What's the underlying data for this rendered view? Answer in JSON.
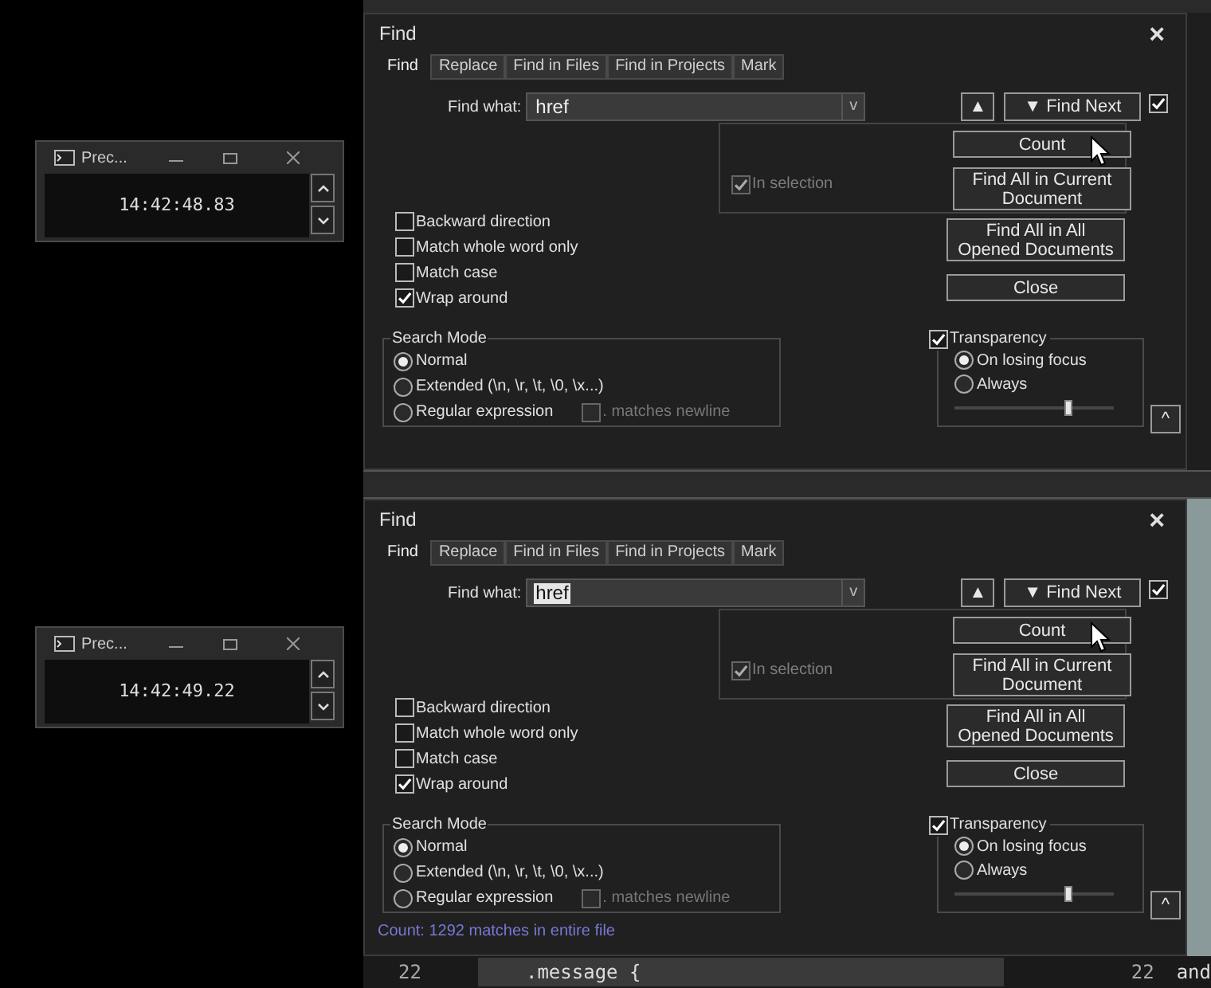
{
  "clocks": [
    {
      "title": "Prec...",
      "time": "14:42:48.83"
    },
    {
      "title": "Prec...",
      "time": "14:42:49.22"
    }
  ],
  "dialogs": [
    {
      "title": "Find",
      "close": "×",
      "tabs": [
        {
          "label": "Find",
          "selected": true
        },
        {
          "label": "Replace",
          "selected": false
        },
        {
          "label": "Find in Files",
          "selected": false
        },
        {
          "label": "Find in Projects",
          "selected": false
        },
        {
          "label": "Mark",
          "selected": false
        }
      ],
      "find_what_label": "Find what:",
      "find_what": "href",
      "text_selected": false,
      "dropdown": "v",
      "up": "▲",
      "find_next": "▼ Find Next",
      "stay_open": true,
      "in_selection": {
        "label": "In selection",
        "checked": true,
        "disabled": true
      },
      "buttons": [
        "Count",
        "Find All in Current Document",
        "Find All in All Opened Documents",
        "Close"
      ],
      "options": [
        {
          "label": "Backward direction",
          "checked": false
        },
        {
          "label": "Match whole word only",
          "checked": false
        },
        {
          "label": "Match case",
          "checked": false
        },
        {
          "label": "Wrap around",
          "checked": true
        }
      ],
      "search_mode": {
        "title": "Search Mode",
        "options": [
          {
            "label": "Normal",
            "selected": true
          },
          {
            "label": "Extended (\\n, \\r, \\t, \\0, \\x...)",
            "selected": false
          },
          {
            "label": "Regular expression",
            "selected": false
          }
        ],
        "dot_newline": {
          "label": ". matches newline",
          "checked": false,
          "disabled": true
        }
      },
      "transparency": {
        "label": "Transparency",
        "checked": true,
        "options": [
          {
            "label": "On losing focus",
            "selected": true
          },
          {
            "label": "Always",
            "selected": false
          }
        ],
        "level": 0.72
      },
      "collapse": "^"
    },
    {
      "title": "Find",
      "close": "×",
      "tabs": [
        {
          "label": "Find",
          "selected": true
        },
        {
          "label": "Replace",
          "selected": false
        },
        {
          "label": "Find in Files",
          "selected": false
        },
        {
          "label": "Find in Projects",
          "selected": false
        },
        {
          "label": "Mark",
          "selected": false
        }
      ],
      "find_what_label": "Find what:",
      "find_what": "href",
      "text_selected": true,
      "dropdown": "v",
      "up": "▲",
      "find_next": "▼ Find Next",
      "stay_open": true,
      "in_selection": {
        "label": "In selection",
        "checked": true,
        "disabled": true
      },
      "buttons": [
        "Count",
        "Find All in Current Document",
        "Find All in All Opened Documents",
        "Close"
      ],
      "options": [
        {
          "label": "Backward direction",
          "checked": false
        },
        {
          "label": "Match whole word only",
          "checked": false
        },
        {
          "label": "Match case",
          "checked": false
        },
        {
          "label": "Wrap around",
          "checked": true
        }
      ],
      "search_mode": {
        "title": "Search Mode",
        "options": [
          {
            "label": "Normal",
            "selected": true
          },
          {
            "label": "Extended (\\n, \\r, \\t, \\0, \\x...)",
            "selected": false
          },
          {
            "label": "Regular expression",
            "selected": false
          }
        ],
        "dot_newline": {
          "label": ". matches newline",
          "checked": false,
          "disabled": true
        }
      },
      "transparency": {
        "label": "Transparency",
        "checked": true,
        "options": [
          {
            "label": "On losing focus",
            "selected": true
          },
          {
            "label": "Always",
            "selected": false
          }
        ],
        "level": 0.72
      },
      "collapse": "^",
      "status": "Count: 1292 matches in entire file"
    }
  ],
  "editor_line": {
    "line_number": "22",
    "code": ".message {",
    "right_line_number": "22",
    "right_code": "and"
  }
}
